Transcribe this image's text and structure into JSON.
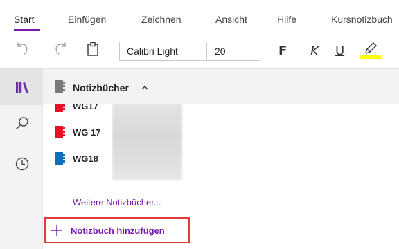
{
  "ribbon": {
    "tabs": [
      {
        "label": "Start",
        "active": true
      },
      {
        "label": "Einfügen"
      },
      {
        "label": "Zeichnen"
      },
      {
        "label": "Ansicht"
      },
      {
        "label": "Hilfe"
      },
      {
        "label": "Kursnotizbuch"
      }
    ]
  },
  "toolbar": {
    "undo_icon": "undo-icon",
    "redo_icon": "redo-icon",
    "clipboard_icon": "clipboard-icon",
    "font_name": "Calibri Light",
    "font_size": "20",
    "bold_label": "F",
    "italic_label": "K",
    "underline_label": "U",
    "highlight_icon": "highlighter-icon",
    "highlight_color": "#ffff00"
  },
  "rail": {
    "items": [
      {
        "icon": "notebooks-icon",
        "active": true
      },
      {
        "icon": "search-icon"
      },
      {
        "icon": "recent-clock-icon"
      }
    ]
  },
  "panel": {
    "title": "Notizbücher",
    "title_chevron_icon": "chevron-up-icon",
    "notebooks": [
      {
        "label": "WG17",
        "color": "#e81123"
      },
      {
        "label": "WG 17",
        "color": "#e81123"
      },
      {
        "label": "WG18",
        "color": "#106ebe"
      }
    ],
    "more_link": "Weitere Notizbücher...",
    "add_button": "Notizbuch hinzufügen"
  },
  "colors": {
    "accent": "#7719aa",
    "focus_border": "#e23b3b"
  }
}
